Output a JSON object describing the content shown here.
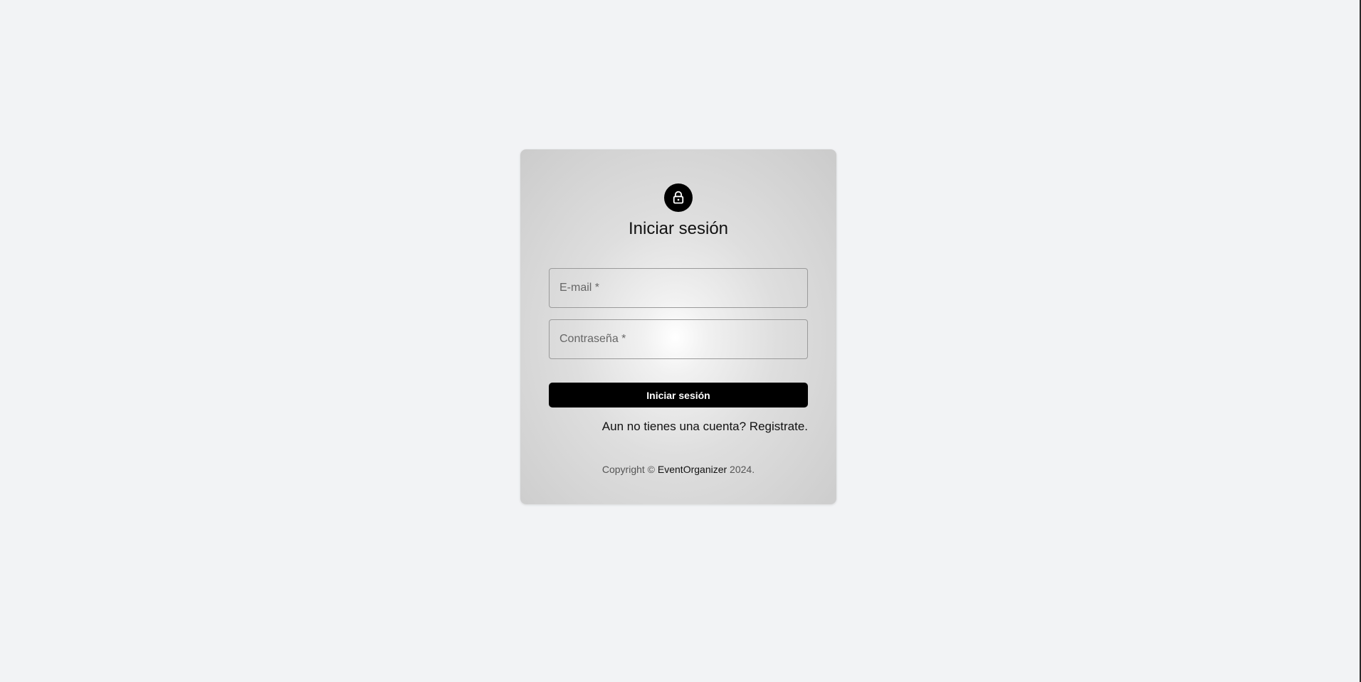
{
  "login": {
    "title": "Iniciar sesión",
    "icon": "lock-icon",
    "email_placeholder": "E-mail *",
    "password_placeholder": "Contraseña *",
    "submit_label": "Iniciar sesión",
    "register_link": "Aun no tienes una cuenta? Registrate.",
    "footer": {
      "prefix": "Copyright © ",
      "brand": "EventOrganizer",
      "suffix": " 2024."
    }
  },
  "colors": {
    "page_background": "#f2f3f5",
    "button_background": "#000000",
    "button_text": "#ffffff"
  }
}
